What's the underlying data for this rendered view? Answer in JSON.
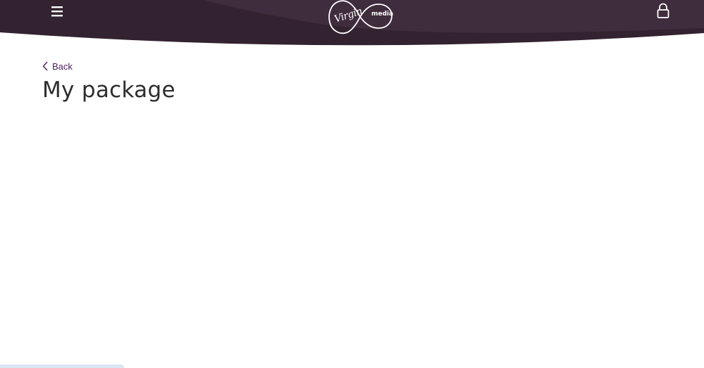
{
  "header": {
    "menu_icon": "hamburger-menu-icon",
    "logo": {
      "script_text": "Virgin",
      "wordmark_text": "media"
    },
    "lock_icon": "lock-icon",
    "colors": {
      "background": "#33222f",
      "wave_light": "#3f2c3d"
    }
  },
  "main": {
    "back_label": "Back",
    "title": "My package"
  },
  "colors": {
    "link": "#4a1d5c",
    "title": "#2d2d2d",
    "bottom_bar": "#dbe6f3"
  }
}
